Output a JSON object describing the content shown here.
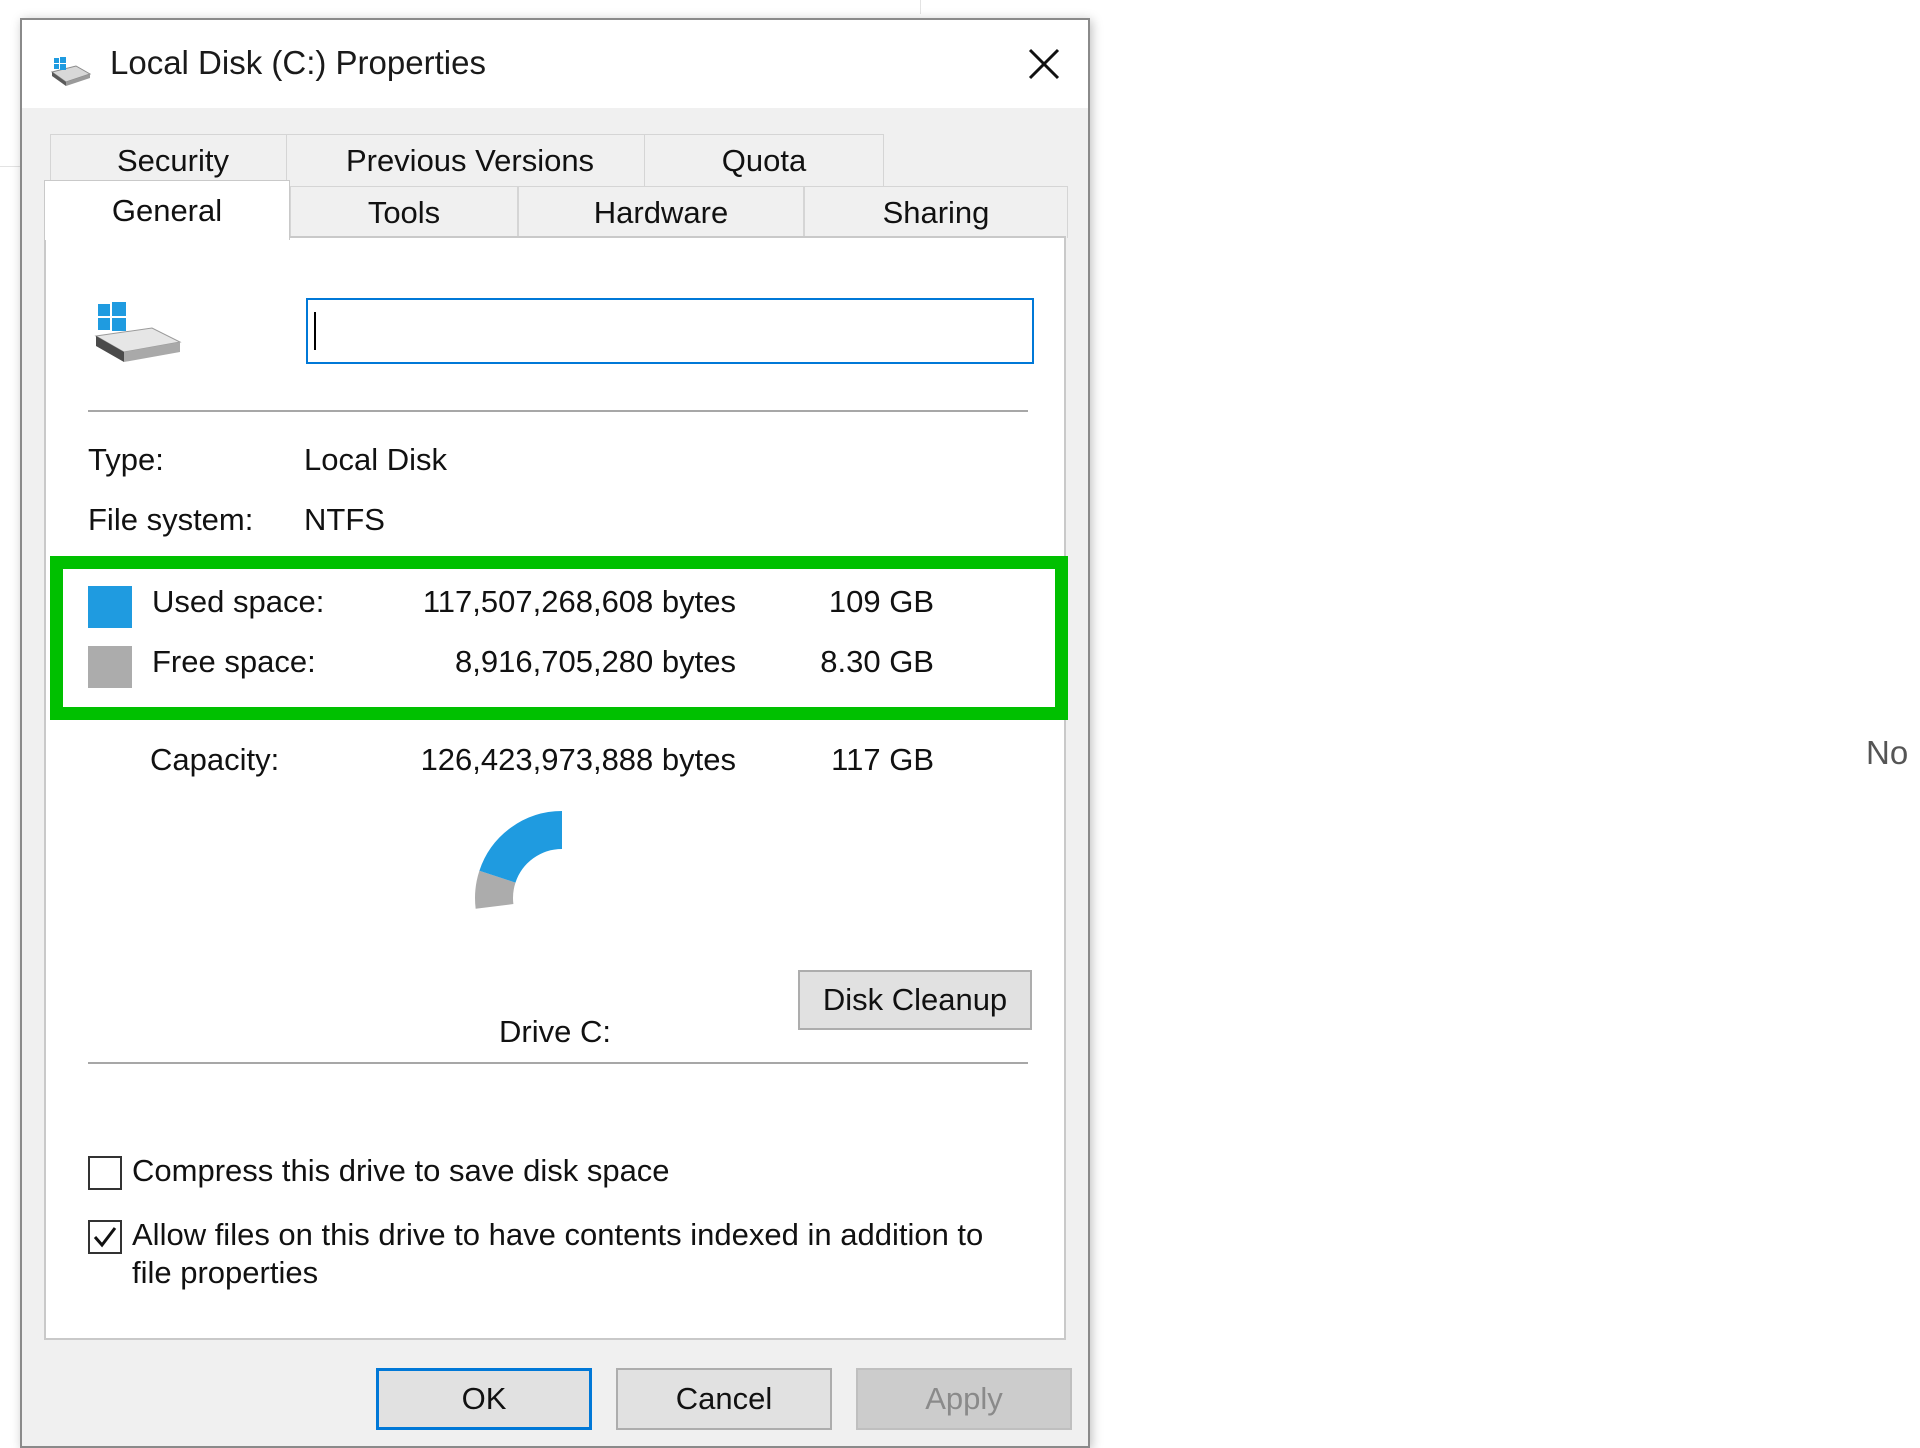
{
  "window": {
    "title": "Local Disk (C:) Properties",
    "close_icon": "close-icon"
  },
  "tabs": {
    "back_row": [
      "Security",
      "Previous Versions",
      "Quota"
    ],
    "front_row": [
      "General",
      "Tools",
      "Hardware",
      "Sharing"
    ],
    "active": "General"
  },
  "general": {
    "volume_label_value": "",
    "type_label": "Type:",
    "type_value": "Local Disk",
    "fs_label": "File system:",
    "fs_value": "NTFS",
    "used": {
      "label": "Used space:",
      "bytes": "117,507,268,608 bytes",
      "size": "109 GB",
      "color": "#1f9be0"
    },
    "free": {
      "label": "Free space:",
      "bytes": "8,916,705,280 bytes",
      "size": "8.30 GB",
      "color": "#acacac"
    },
    "capacity": {
      "label": "Capacity:",
      "bytes": "126,423,973,888 bytes",
      "size": "117 GB"
    },
    "drive_label": "Drive C:",
    "disk_cleanup_label": "Disk Cleanup",
    "compress": {
      "label": "Compress this drive to save disk space",
      "checked": false
    },
    "index": {
      "label_line1": "Allow files on this drive to have contents indexed in addition to",
      "label_line2": "file properties",
      "checked": true
    }
  },
  "chart_data": {
    "type": "pie",
    "categories": [
      "Used space",
      "Free space"
    ],
    "values": [
      117507268608,
      8916705280
    ],
    "colors": [
      "#1f9be0",
      "#acacac"
    ]
  },
  "highlight_color": "#00c000",
  "footer": {
    "ok_label": "OK",
    "cancel_label": "Cancel",
    "apply_label": "Apply"
  },
  "background": {
    "partial_text": "No"
  }
}
